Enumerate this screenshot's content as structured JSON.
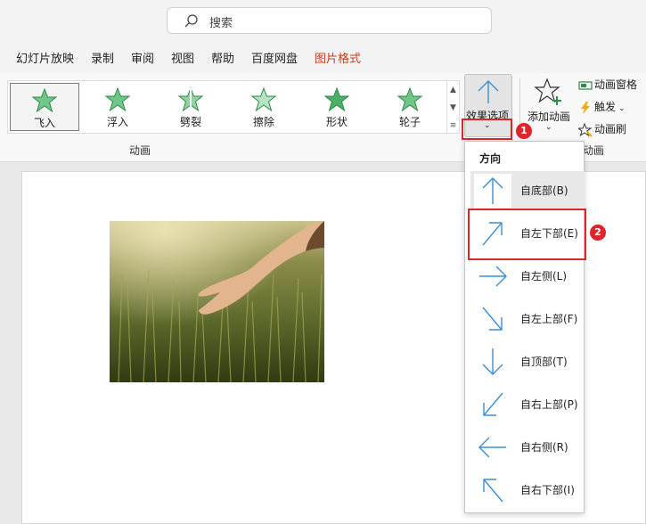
{
  "search": {
    "placeholder": "搜索"
  },
  "menu": [
    {
      "label": "幻灯片放映"
    },
    {
      "label": "录制"
    },
    {
      "label": "审阅"
    },
    {
      "label": "视图"
    },
    {
      "label": "帮助"
    },
    {
      "label": "百度网盘"
    },
    {
      "label": "图片格式"
    }
  ],
  "ribbon": {
    "animations": [
      {
        "label": "飞入"
      },
      {
        "label": "浮入"
      },
      {
        "label": "劈裂"
      },
      {
        "label": "擦除"
      },
      {
        "label": "形状"
      },
      {
        "label": "轮子"
      }
    ],
    "effect_options_label": "效果选项",
    "add_animation_label": "添加动画",
    "animation_pane_label": "动画窗格",
    "trigger_label": "触发",
    "animation_painter_label": "动画刷",
    "group_animation_label": "动画",
    "group_advanced_label": "动画"
  },
  "badges": {
    "step1": "1",
    "step2": "2"
  },
  "dropdown": {
    "header": "方向",
    "items": [
      {
        "label": "自底部(B)",
        "icon": "arrow-up-icon"
      },
      {
        "label": "自左下部(E)",
        "icon": "arrow-up-right-icon"
      },
      {
        "label": "自左侧(L)",
        "icon": "arrow-right-icon"
      },
      {
        "label": "自左上部(F)",
        "icon": "arrow-down-right-icon"
      },
      {
        "label": "自顶部(T)",
        "icon": "arrow-down-icon"
      },
      {
        "label": "自右上部(P)",
        "icon": "arrow-down-left-icon"
      },
      {
        "label": "自右侧(R)",
        "icon": "arrow-left-icon"
      },
      {
        "label": "自右下部(I)",
        "icon": "arrow-up-left-icon"
      }
    ]
  },
  "colors": {
    "accent": "#c43e1c",
    "highlight": "#e0242c",
    "arrow": "#3b8fd6",
    "star": "#4caf68"
  }
}
